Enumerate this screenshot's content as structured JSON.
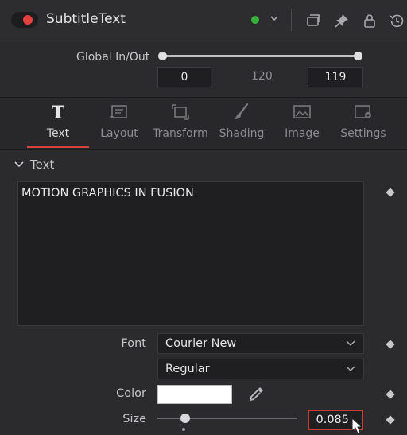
{
  "header": {
    "title": "SubtitleText",
    "enable_toggle_color": "#e2403a",
    "status_color": "#36b23b",
    "icons": [
      "toggle-icon",
      "status-dot",
      "chevron-down-icon",
      "versions-icon",
      "pin-icon",
      "lock-icon",
      "reset-icon"
    ]
  },
  "global_in_out": {
    "label": "Global In/Out",
    "in_value": "0",
    "mid_value": "120",
    "out_value": "119"
  },
  "tabs": [
    {
      "label": "Text",
      "icon": "text-tool-icon",
      "active": true
    },
    {
      "label": "Layout",
      "icon": "layout-icon",
      "active": false
    },
    {
      "label": "Transform",
      "icon": "transform-icon",
      "active": false
    },
    {
      "label": "Shading",
      "icon": "shading-brush-icon",
      "active": false
    },
    {
      "label": "Image",
      "icon": "image-icon",
      "active": false
    },
    {
      "label": "Settings",
      "icon": "settings-icon",
      "active": false
    }
  ],
  "section": {
    "label": "Text",
    "styled_text": "MOTION GRAPHICS IN FUSION"
  },
  "font": {
    "label": "Font",
    "family": "Courier New",
    "style": "Regular"
  },
  "color": {
    "label": "Color",
    "value": "#ffffff"
  },
  "size": {
    "label": "Size",
    "value": "0.085",
    "highlight_color": "#d23b33"
  }
}
